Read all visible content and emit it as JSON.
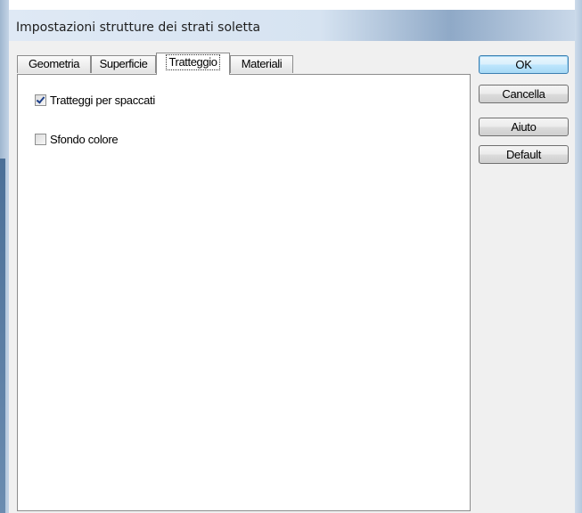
{
  "window": {
    "title": "Impostazioni strutture dei strati soletta"
  },
  "tabs": [
    {
      "label": "Geometria",
      "active": false
    },
    {
      "label": "Superficie",
      "active": false
    },
    {
      "label": "Tratteggio",
      "active": true
    },
    {
      "label": "Materiali",
      "active": false
    }
  ],
  "panel": {
    "options": [
      {
        "label": "Tratteggi per spaccati",
        "checked": true
      },
      {
        "label": "Sfondo colore",
        "checked": false
      }
    ]
  },
  "buttons": {
    "ok": "OK",
    "cancel": "Cancella",
    "help": "Aiuto",
    "default": "Default"
  },
  "colors": {
    "client_bg": "#f0f0f0",
    "panel_bg": "#ffffff",
    "default_button_border": "#3c7fb1"
  }
}
